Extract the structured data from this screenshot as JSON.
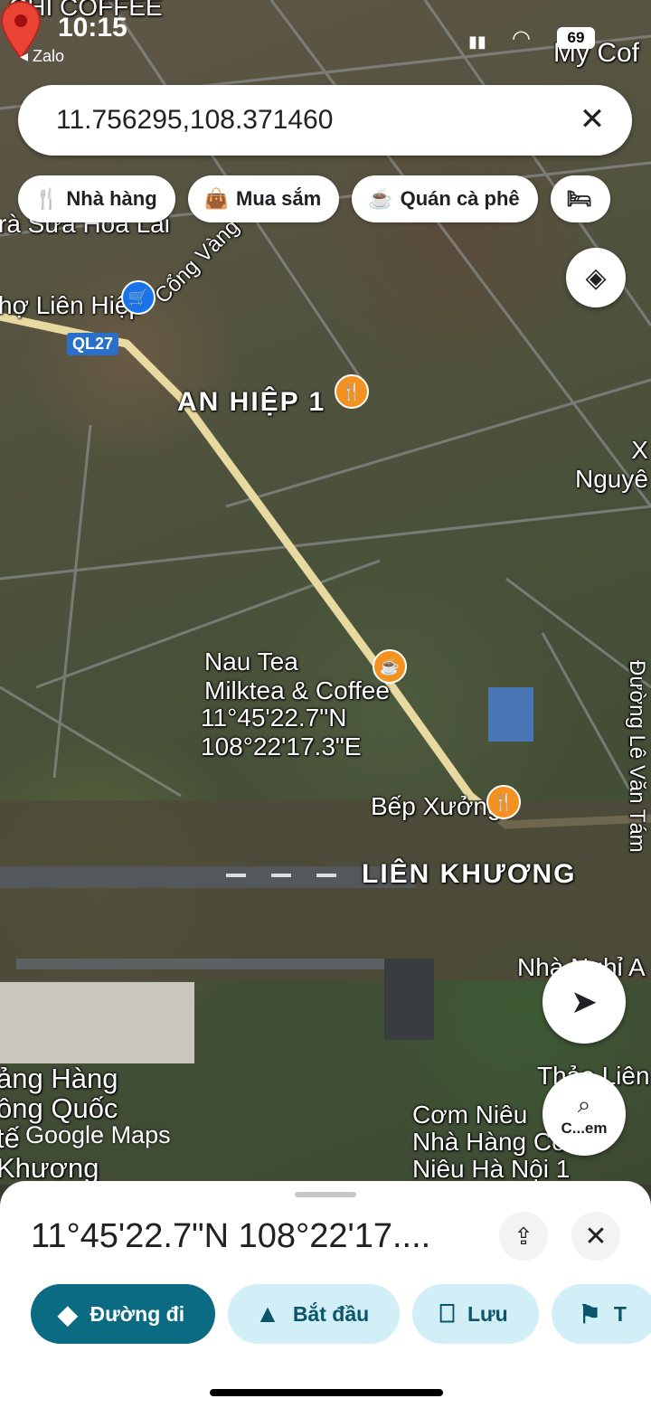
{
  "status_bar": {
    "time": "10:15",
    "back_app": "◂ Zalo",
    "battery": "69"
  },
  "search": {
    "query": "11.756295,108.371460"
  },
  "chips": [
    {
      "icon": "fork-knife-icon",
      "label": "Nhà hàng"
    },
    {
      "icon": "shopping-bag-icon",
      "label": "Mua sắm"
    },
    {
      "icon": "coffee-cup-icon",
      "label": "Quán cà phê"
    }
  ],
  "map_labels": {
    "top_left_cafe": "CHI COFFEE",
    "top_right_cafe": "My Cof",
    "milk_tea": "rà Sữa Hoa Lai",
    "market": "hợ Liên Hiệp",
    "road_cong_vang": "Cổng Vàng",
    "ql27": "QL27",
    "area_an_hiep": "AN HIỆP 1",
    "area_nguyen": "X\nNguyê",
    "nau_tea": "Nau Tea\nMilktea & Coffee",
    "pin_lat": "11°45'22.7\"N",
    "pin_lng": "108°22'17.3\"E",
    "bep_xuong": "Bếp Xưởng",
    "lien_khuong": "LIÊN KHƯƠNG",
    "duong_le_van_tam": "Đường Lê Văn Tám",
    "nha_nghi": "Nhà Nghỉ A",
    "thao_lien": "Thảo Liên",
    "airport": "ảng Hàng\nông Quốc\ntế\nKhương",
    "com_nieu": "Cơm Niêu\nNhà Hàng Cơm\nNiêu Hà Nội 1"
  },
  "watermark": "Google Maps",
  "lens_button": {
    "label": "C...em"
  },
  "sheet": {
    "coordinates": "11°45'22.7\"N 108°22'17....",
    "actions": [
      {
        "icon": "directions-icon",
        "label": "Đường đi",
        "primary": true
      },
      {
        "icon": "navigation-arrow-icon",
        "label": "Bắt đầu",
        "primary": false
      },
      {
        "icon": "bookmark-icon",
        "label": "Lưu",
        "primary": false
      },
      {
        "icon": "flag-icon",
        "label": "T",
        "primary": false
      }
    ]
  },
  "colors": {
    "primary": "#0b6b82",
    "tonal": "#d2eef7",
    "poi": "#f39121",
    "pin": "#ea4335",
    "road": "#e8d9a0"
  }
}
